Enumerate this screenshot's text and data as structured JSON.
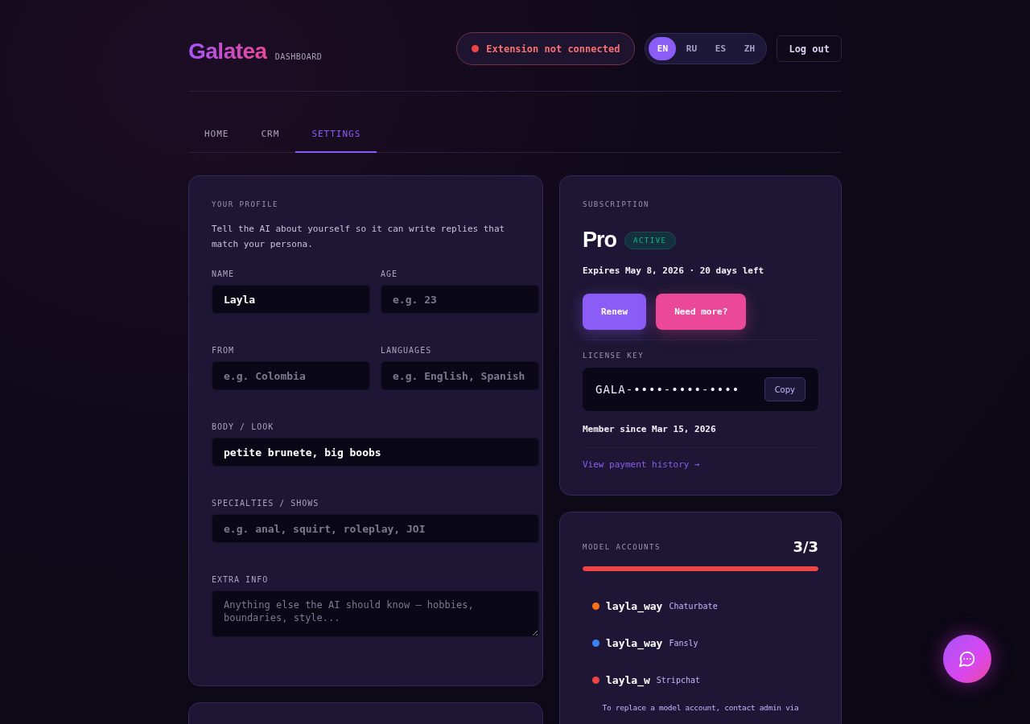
{
  "header": {
    "logo": "Galatea",
    "logo_subtitle": "DASHBOARD",
    "extension_status": {
      "text": "Extension not connected",
      "connected": false
    },
    "languages": [
      {
        "label": "EN",
        "selected": true
      },
      {
        "label": "RU",
        "selected": false
      },
      {
        "label": "ES",
        "selected": false
      },
      {
        "label": "ZH",
        "selected": false
      }
    ],
    "logout": "Log out"
  },
  "tabs": [
    {
      "label": "HOME",
      "selected": false
    },
    {
      "label": "CRM",
      "selected": false
    },
    {
      "label": "SETTINGS",
      "selected": true
    }
  ],
  "profile": {
    "title": "YOUR PROFILE",
    "description": "Tell the AI about yourself so it can write replies that match your persona.",
    "fields": [
      {
        "kind": "half",
        "label": "NAME",
        "value": "Layla"
      },
      {
        "kind": "half",
        "label": "AGE",
        "placeholder": "e.g. 23"
      },
      {
        "kind": "half",
        "label": "FROM",
        "placeholder": "e.g. Colombia"
      },
      {
        "kind": "half",
        "label": "LANGUAGES",
        "placeholder": "e.g. English, Spanish"
      },
      {
        "kind": "full",
        "label": "BODY / LOOK",
        "value": "petite brunete, big boobs"
      },
      {
        "kind": "full",
        "label": "SPECIALTIES / SHOWS",
        "placeholder": "e.g. anal, squirt, roleplay, JOI"
      },
      {
        "kind": "textarea",
        "label": "EXTRA INFO",
        "placeholder": "Anything else the AI should know — hobbies, boundaries, style..."
      }
    ]
  },
  "subscription": {
    "title": "SUBSCRIPTION",
    "plan": "Pro",
    "status": "ACTIVE",
    "expiry": "Expires May 8, 2026 · 20 days left",
    "buttons": [
      {
        "label": "Renew",
        "kind": "primary"
      },
      {
        "label": "Need more?",
        "kind": "accent"
      }
    ],
    "license_label": "LICENSE KEY",
    "license_key": "GALA-••••-••••-••••",
    "copy": "Copy",
    "member_since": "Member since Mar 15, 2026",
    "payment_link": "View payment history →"
  },
  "model_accounts": {
    "title": "MODEL ACCOUNTS",
    "count": "3/3",
    "level": 1,
    "accounts": [
      {
        "username": "layla_way",
        "platform": "Chaturbate",
        "color": "#f97316"
      },
      {
        "username": "layla_way",
        "platform": "Fansly",
        "color": "#3b82f6"
      },
      {
        "username": "layla_w",
        "platform": "Stripchat",
        "color": "#ef4444"
      }
    ],
    "note": "To replace a model account, contact admin via"
  }
}
